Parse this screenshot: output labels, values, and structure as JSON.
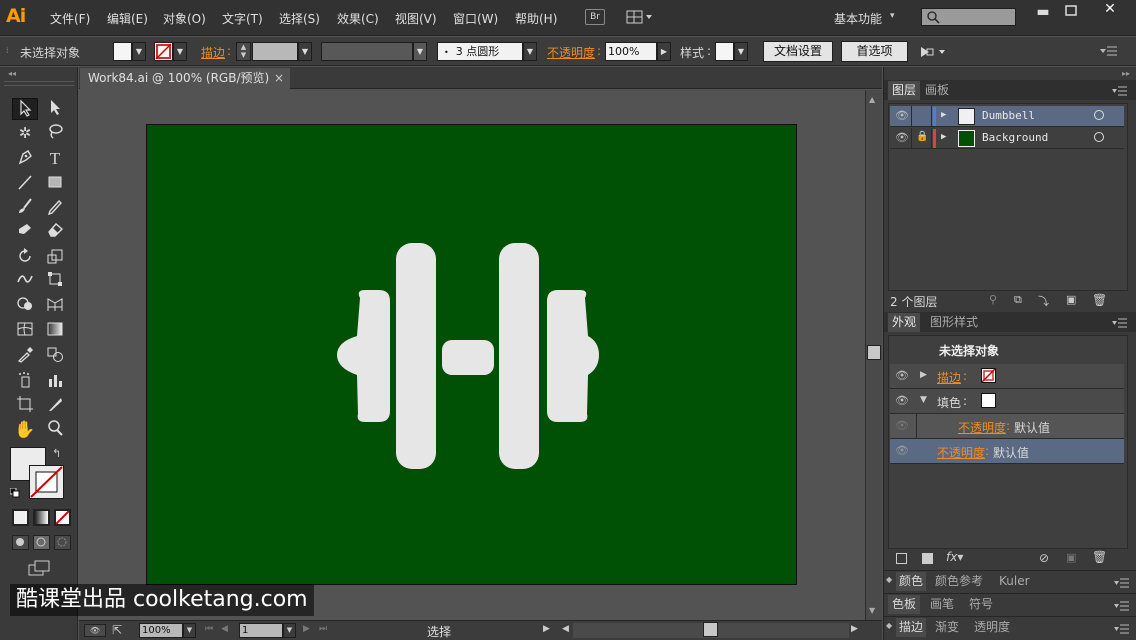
{
  "app": {
    "logo": "Ai"
  },
  "menu": {
    "items": [
      "文件(F)",
      "编辑(E)",
      "对象(O)",
      "文字(T)",
      "选择(S)",
      "效果(C)",
      "视图(V)",
      "窗口(W)",
      "帮助(H)"
    ],
    "bridge": "Br",
    "workspace": "基本功能"
  },
  "control": {
    "selection_status": "未选择对象",
    "stroke_label": "描边",
    "brush_value": "3 点圆形",
    "opacity_label": "不透明度",
    "opacity_value": "100%",
    "style_label": "样式",
    "doc_setup_button": "文档设置",
    "prefs_button": "首选项"
  },
  "document": {
    "tab_title": "Work84.ai @ 100% (RGB/预览)",
    "close_glyph": "×",
    "artboard_color": "#005005",
    "art_color": "#e6e6e6"
  },
  "layers_panel": {
    "tabs": [
      "图层",
      "画板"
    ],
    "layers": [
      {
        "name": "Dumbbell",
        "color": "#4a7fd1",
        "locked": false,
        "selected": true,
        "thumb": "#f0f0f0"
      },
      {
        "name": "Background",
        "color": "#e0403a",
        "locked": true,
        "selected": false,
        "thumb": "#005005"
      }
    ],
    "footer": "2 个图层"
  },
  "appearance_panel": {
    "tabs": [
      "外观",
      "图形样式"
    ],
    "header": "未选择对象",
    "stroke_label": "描边",
    "fill_label": "填色",
    "fill_opacity_label": "不透明度",
    "fill_opacity_value": "默认值",
    "opacity_label": "不透明度",
    "opacity_value": "默认值"
  },
  "color_panel_tabs": [
    "颜色",
    "颜色参考",
    "Kuler"
  ],
  "swatch_panel_tabs": [
    "色板",
    "画笔",
    "符号"
  ],
  "stroke_panel_tabs": [
    "描边",
    "渐变",
    "透明度"
  ],
  "status": {
    "zoom": "100%",
    "artboard_index": "1",
    "tool_label": "选择"
  },
  "watermark": "酷课堂出品 coolketang.com"
}
